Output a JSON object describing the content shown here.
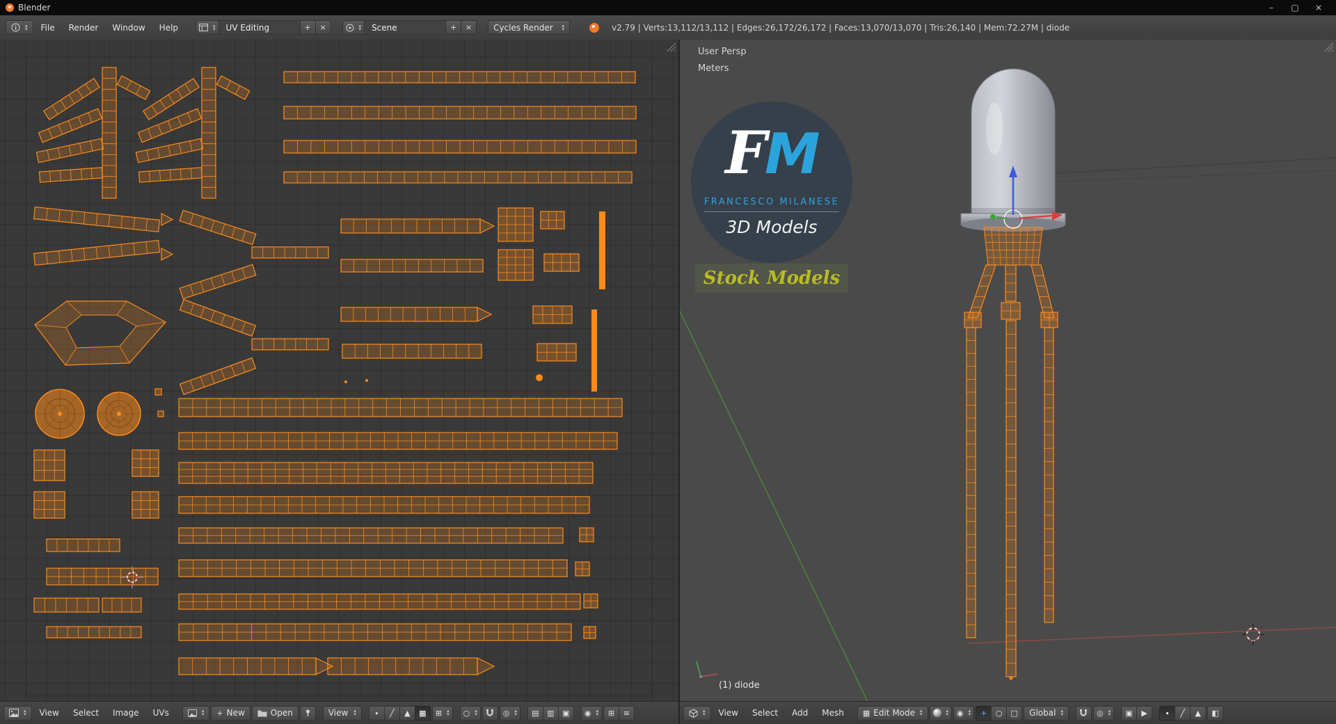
{
  "window": {
    "title": "Blender"
  },
  "info": {
    "menus": [
      "File",
      "Render",
      "Window",
      "Help"
    ],
    "layout_value": "UV Editing",
    "scene_value": "Scene",
    "engine_value": "Cycles Render",
    "stats": "v2.79 | Verts:13,112/13,112 | Edges:26,172/26,172 | Faces:13,070/13,070 | Tris:26,140 | Mem:72.27M | diode"
  },
  "uv_editor": {
    "menus": [
      "View",
      "Select",
      "Image",
      "UVs"
    ],
    "new_label": "New",
    "open_label": "Open",
    "mode_value": "View"
  },
  "viewport": {
    "view_name": "User Persp",
    "unit_system": "Meters",
    "object_info": "(1) diode",
    "menus": [
      "View",
      "Select",
      "Add",
      "Mesh"
    ],
    "mode_value": "Edit Mode",
    "orientation_value": "Global",
    "logo": {
      "f": "F",
      "m": "M",
      "name": "FRANCESCO MILANESE",
      "tagline": "3D Models",
      "banner": "Stock Models"
    }
  },
  "colors": {
    "uv_orange": "#ff8c1a",
    "axis_blue": "#3c5bdc",
    "axis_red": "#d94040",
    "axis_green": "#3fa03f",
    "logo_blue": "#2ba4dd",
    "banner_yellow": "#b9bc20"
  }
}
